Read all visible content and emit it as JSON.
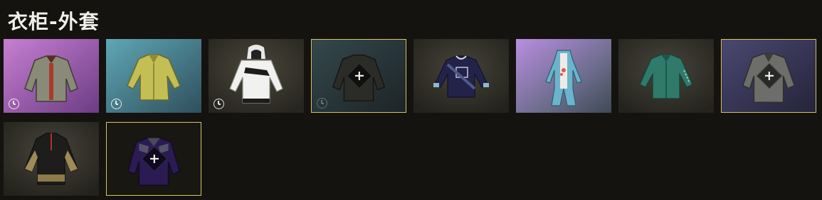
{
  "wardrobe": {
    "title": "衣柜-外套"
  },
  "items": [
    {
      "id": "slot-1",
      "icon": "bomber-jacket-icon",
      "rarity_color": "#b36ac2",
      "has_timer": true,
      "timer_dim": false,
      "selected": false,
      "equip_plus": false
    },
    {
      "id": "slot-2",
      "icon": "yellow-shirt-icon",
      "rarity_color": "#4f8ea0",
      "has_timer": true,
      "timer_dim": false,
      "selected": false,
      "equip_plus": false
    },
    {
      "id": "slot-3",
      "icon": "white-hoodie-icon",
      "rarity_color": "#3c3a30",
      "has_timer": true,
      "timer_dim": false,
      "selected": false,
      "equip_plus": false
    },
    {
      "id": "slot-4",
      "icon": "dark-jacket-icon",
      "rarity_color": "#2c3a3e",
      "has_timer": true,
      "timer_dim": true,
      "selected": true,
      "equip_plus": true
    },
    {
      "id": "slot-5",
      "icon": "navy-sweatshirt-icon",
      "rarity_color": "#3a3930",
      "has_timer": false,
      "timer_dim": false,
      "selected": false,
      "equip_plus": false
    },
    {
      "id": "slot-6",
      "icon": "blue-onesie-icon",
      "rarity_color": "#9a6fc4",
      "has_timer": false,
      "timer_dim": false,
      "selected": false,
      "equip_plus": false
    },
    {
      "id": "slot-7",
      "icon": "green-shirt-icon",
      "rarity_color": "#3c3a30",
      "has_timer": false,
      "timer_dim": false,
      "selected": false,
      "equip_plus": false
    },
    {
      "id": "slot-8",
      "icon": "grey-coat-icon",
      "rarity_color": "#3b3a58",
      "has_timer": false,
      "timer_dim": false,
      "selected": true,
      "equip_plus": true
    },
    {
      "id": "slot-9",
      "icon": "camo-windbreaker-icon",
      "rarity_color": "#3a3930",
      "has_timer": false,
      "timer_dim": false,
      "selected": false,
      "equip_plus": false
    },
    {
      "id": "slot-10",
      "icon": "purple-jacket-icon",
      "rarity_color": "#1a1915",
      "has_timer": false,
      "timer_dim": false,
      "selected": true,
      "equip_plus": true
    }
  ]
}
